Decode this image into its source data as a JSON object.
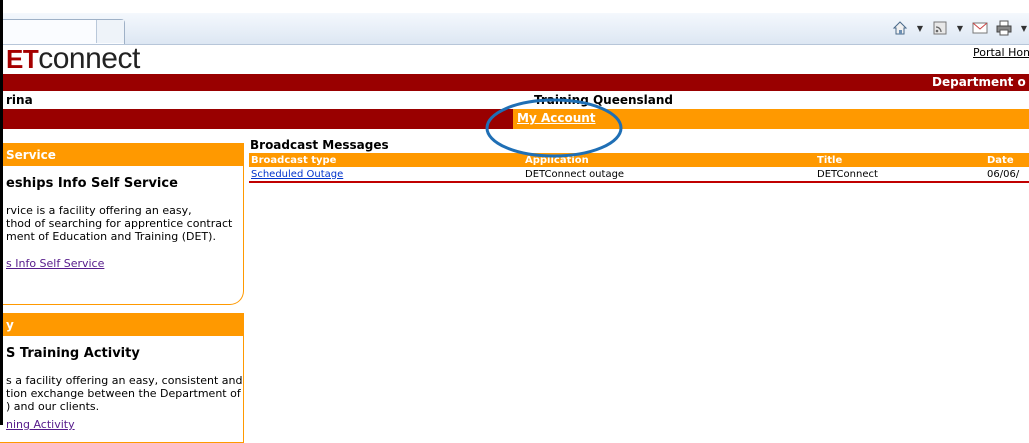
{
  "browser": {
    "toolbar_icons": [
      "home-icon",
      "feeds-icon",
      "mail-icon",
      "print-icon"
    ]
  },
  "header": {
    "logo_lead": "ET",
    "logo_rest": "connect",
    "portal_home": "Portal Home",
    "department": "Department o",
    "user_name": "rina",
    "region": "Training Queensland"
  },
  "nav": {
    "active_tab": "My Account"
  },
  "colors": {
    "brand_red": "#990000",
    "accent_orange": "#ff9900",
    "annotation_blue": "#1f6fb5"
  },
  "left_boxes": [
    {
      "bar": "Service",
      "title": "eships Info Self Service",
      "desc": [
        "rvice is a facility offering an easy,",
        "thod of searching for apprentice contract",
        "ment of Education and Training (DET)."
      ],
      "link": "s Info Self Service"
    },
    {
      "bar": "y",
      "title": "S Training Activity",
      "desc": [
        "s a facility offering an easy, consistent and",
        "tion exchange between the Department of",
        ") and our clients."
      ],
      "link": "ning Activity"
    }
  ],
  "broadcast": {
    "title": "Broadcast Messages",
    "columns": [
      "Broadcast type",
      "Application",
      "Title",
      "Date"
    ],
    "rows": [
      {
        "type": "Scheduled Outage",
        "application": "DETConnect outage",
        "title": "DETConnect",
        "date": "06/06/"
      }
    ]
  }
}
